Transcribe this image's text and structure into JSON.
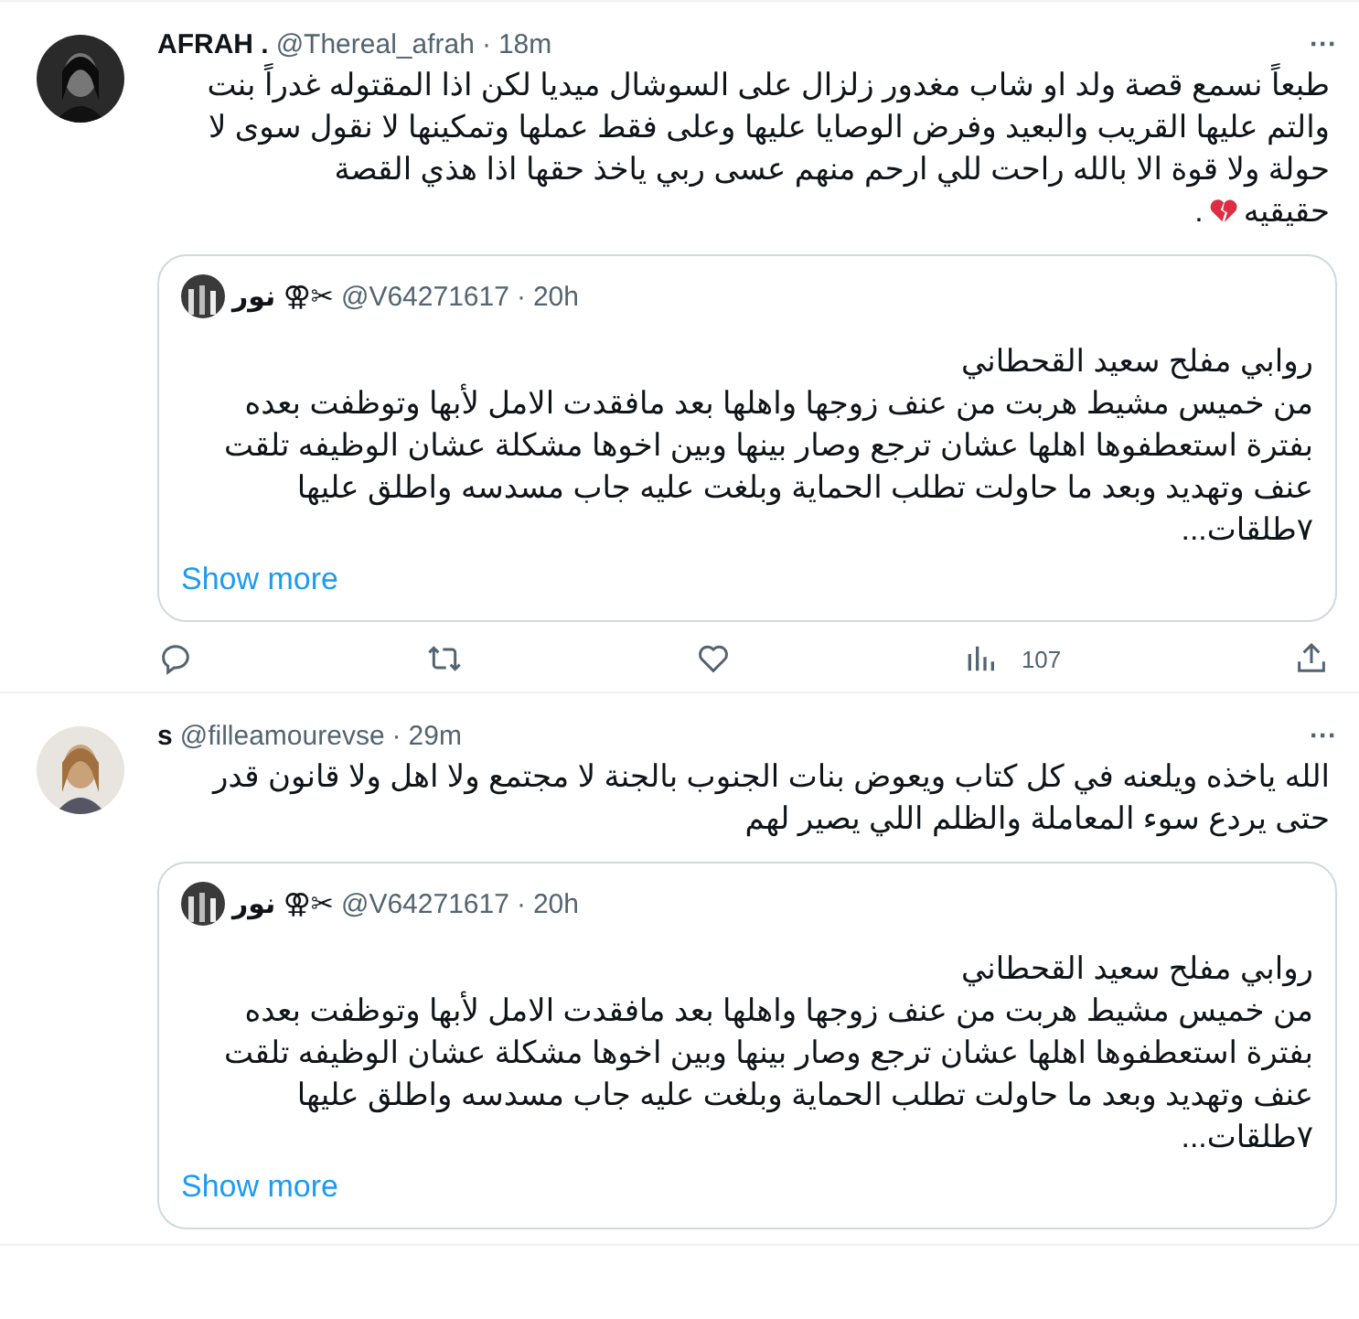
{
  "tweets": [
    {
      "name": "AFRAH .",
      "handle": "@Thereal_afrah",
      "time": "18m",
      "text": "طبعاً نسمع قصة ولد او شاب مغدور زلزال على السوشال ميديا لكن اذا المقتوله غدراً بنت والتم عليها القريب والبعيد وفرض الوصايا عليها وعلى فقط عملها وتمكينها لا نقول سوى لا حولة ولا قوة الا بالله راحت للي ارحم منهم عسى ربي ياخذ حقها اذا هذي القصة",
      "last_line": "حقيقيه",
      "text_end": ".",
      "more": "···",
      "sep": "·",
      "quote": {
        "name": "نور ⚢✂",
        "handle": "@V64271617",
        "time": "20h",
        "text": "روابي مفلح سعيد القحطاني\nمن خميس مشيط هربت من عنف زوجها واهلها بعد مافقدت الامل لأبها وتوظفت بعده بفترة استعطفوها اهلها عشان ترجع وصار بينها وبين اخوها مشكلة عشان الوظيفه تلقت عنف وتهديد وبعد ما حاولت تطلب الحماية وبلغت عليه جاب مسدسه واطلق عليها ٧طلقات...",
        "show_more": "Show more",
        "sep": "·"
      },
      "views": "107"
    },
    {
      "name": "s",
      "handle": "@filleamourevse",
      "time": "29m",
      "text": "الله ياخذه ويلعنه في كل كتاب ويعوض بنات الجنوب بالجنة لا مجتمع ولا اهل ولا قانون قدر حتى يردع سوء المعاملة والظلم اللي يصير لهم",
      "more": "···",
      "sep": "·",
      "quote": {
        "name": "نور ⚢✂",
        "handle": "@V64271617",
        "time": "20h",
        "text": "روابي مفلح سعيد القحطاني\nمن خميس مشيط هربت من عنف زوجها واهلها بعد مافقدت الامل لأبها وتوظفت بعده بفترة استعطفوها اهلها عشان ترجع وصار بينها وبين اخوها مشكلة عشان الوظيفه تلقت عنف وتهديد وبعد ما حاولت تطلب الحماية وبلغت عليه جاب مسدسه واطلق عليها ٧طلقات...",
        "show_more": "Show more",
        "sep": "·"
      }
    }
  ]
}
